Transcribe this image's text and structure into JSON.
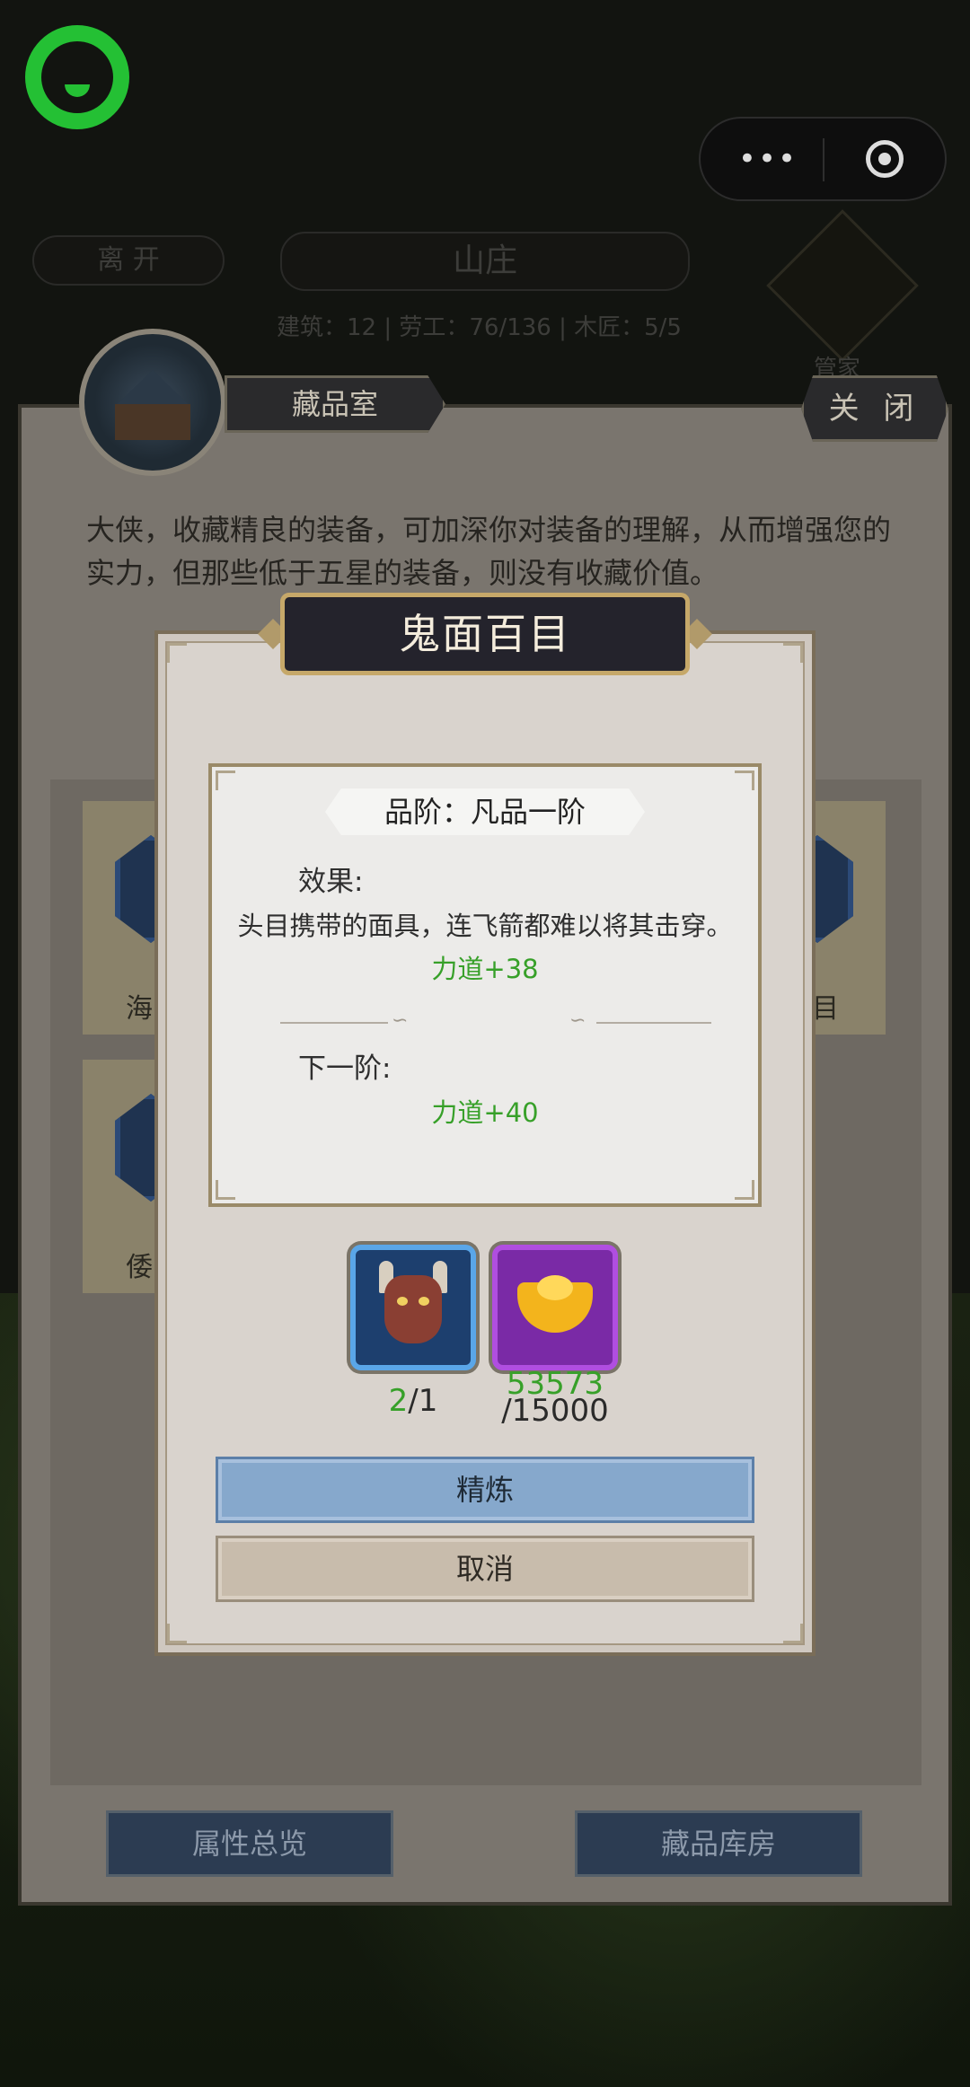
{
  "top_bar": {
    "leave_label": "离 开",
    "manor_title": "山庄",
    "stats_text": "建筑：12  |  劳工：76/136  |  木匠：5/5",
    "emblem_label": "管家"
  },
  "panel": {
    "tab_label": "藏品室",
    "close_label": "关 闭",
    "description": "大侠，收藏精良的装备，可加深你对装备的理解，从而增强您的实力，但那些低于五星的装备，则没有收藏价值。",
    "tiles": [
      {
        "label_partial": "海"
      },
      {
        "label_partial": "目"
      },
      {
        "label_partial": "倭"
      }
    ],
    "attr_overview_label": "属性总览",
    "storage_label": "藏品库房"
  },
  "dialog": {
    "title": "鬼面百目",
    "grade": "品阶：凡品一阶",
    "effect_label": "效果:",
    "effect_desc": "头目携带的面具，连飞箭都难以将其击穿。",
    "current_bonus": "力道+38",
    "next_label": "下一阶:",
    "next_bonus": "力道+40",
    "items": [
      {
        "icon": "ghost-mask-icon",
        "have": "2",
        "need": "/1"
      },
      {
        "icon": "gold-ingot-icon",
        "have": "53573",
        "need": "/15000"
      }
    ],
    "refine_label": "精炼",
    "cancel_label": "取消"
  },
  "colors": {
    "have_green": "#37a029",
    "refine_blue": "#86a8cc",
    "title_gold": "#c6a869"
  }
}
